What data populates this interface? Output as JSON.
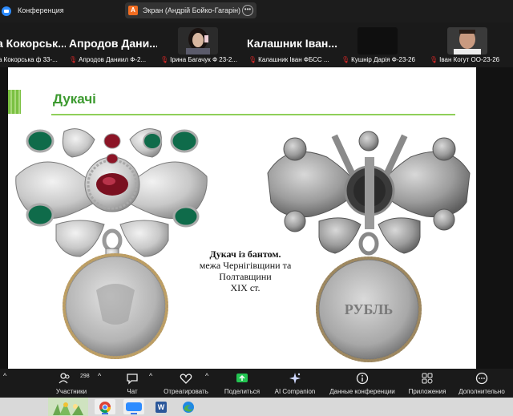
{
  "window": {
    "title": "Конференция",
    "share_badge": "A",
    "share_label": "Экран (Андрій Бойко-Гагарін)",
    "share_more_icon": "ellipsis-icon"
  },
  "participants": [
    {
      "name": "а Кокорськ...",
      "caption": "а Кокорська ф 33-..."
    },
    {
      "name": "Апродов Дани...",
      "caption": "Апродов Даниил Ф-2..."
    },
    {
      "name": "",
      "caption": "Ірина Багачук Ф 23-2..."
    },
    {
      "name": "Калашник Іван...",
      "caption": "Калашник Іван ФБСС ..."
    },
    {
      "name": "",
      "caption": "Кушнір Дарія Ф-23-26"
    },
    {
      "name": "",
      "caption": "Іван Когут ОО-23-26"
    }
  ],
  "slide": {
    "title": "Дукачі",
    "caption_line1": "Дукач із бантом.",
    "caption_line2": "межа Чернігівщини та",
    "caption_line3": "Полтавщини",
    "caption_line4": "XIX ст.",
    "coin_text": "РУБЛЬ"
  },
  "toolbar": {
    "participants_label": "Участники",
    "participants_count": "298",
    "chat_label": "Чат",
    "react_label": "Отреагировать",
    "share_label": "Поделиться",
    "ai_label": "AI Companion",
    "meeting_info_label": "Данные конференции",
    "apps_label": "Приложения",
    "more_label": "Дополнительно"
  },
  "colors": {
    "accent_green": "#3c9a2f",
    "share_green": "#23c552",
    "mute_red": "#e02828"
  }
}
